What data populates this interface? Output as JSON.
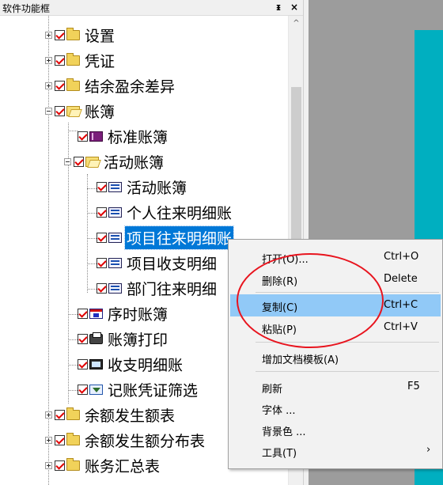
{
  "panel": {
    "title": "软件功能框",
    "pin_glyph": "ᵻ",
    "close_glyph": "×"
  },
  "tree": {
    "items": [
      {
        "label": "设置",
        "icon": "closed-folder-icon"
      },
      {
        "label": "凭证",
        "icon": "closed-folder-icon"
      },
      {
        "label": "结余盈余差异",
        "icon": "closed-folder-icon"
      },
      {
        "label": "账簿",
        "icon": "open-folder-icon"
      },
      {
        "label": "标准账簿",
        "icon": "book-icon"
      },
      {
        "label": "活动账簿",
        "icon": "open-folder-icon"
      },
      {
        "label": "活动账簿",
        "icon": "ledger-icon"
      },
      {
        "label": "个人往来明细账",
        "icon": "ledger-icon"
      },
      {
        "label": "项目往来明细账",
        "icon": "ledger-icon",
        "selected": true
      },
      {
        "label": "项目收支明细",
        "icon": "ledger-icon"
      },
      {
        "label": "部门往来明细",
        "icon": "ledger-icon"
      },
      {
        "label": "序时账簿",
        "icon": "calendar-icon"
      },
      {
        "label": "账簿打印",
        "icon": "printer-icon"
      },
      {
        "label": "收支明细账",
        "icon": "monitor-icon"
      },
      {
        "label": "记账凭证筛选",
        "icon": "filter-icon"
      },
      {
        "label": "余额发生额表",
        "icon": "closed-folder-icon"
      },
      {
        "label": "余额发生额分布表",
        "icon": "closed-folder-icon"
      },
      {
        "label": "账务汇总表",
        "icon": "closed-folder-icon"
      }
    ]
  },
  "scrollbar": {
    "up_glyph": "^"
  },
  "context_menu": {
    "items": [
      {
        "label": "打开(O)...",
        "shortcut": "Ctrl+O"
      },
      {
        "label": "删除(R)",
        "shortcut": "Delete"
      },
      {
        "label": "复制(C)",
        "shortcut": "Ctrl+C",
        "highlighted": true
      },
      {
        "label": "粘贴(P)",
        "shortcut": "Ctrl+V"
      },
      {
        "label": "增加文档模板(A)",
        "shortcut": ""
      },
      {
        "label": "刷新",
        "shortcut": "F5"
      },
      {
        "label": "字体 ...",
        "shortcut": ""
      },
      {
        "label": "背景色 ...",
        "shortcut": ""
      },
      {
        "label": "工具(T)",
        "shortcut": "",
        "submenu_glyph": "›"
      }
    ]
  },
  "colors": {
    "selection": "#0078d7",
    "menu_highlight": "#91c9f7",
    "annotation_oval": "#e8141e",
    "teal": "#00afc0"
  }
}
